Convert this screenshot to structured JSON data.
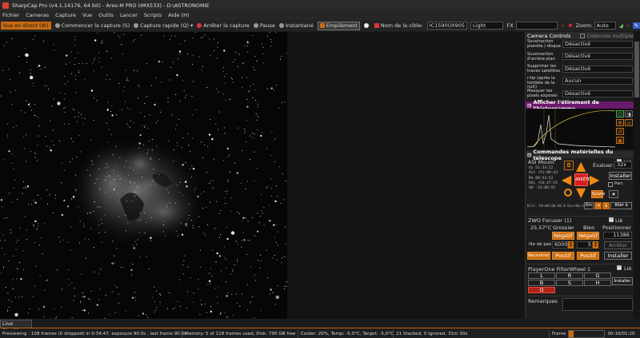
{
  "title": "SharpCap Pro (v4.1.14176, 64 bit) - Ares-M PRO (IMX533) - D:\\ASTRONOMIE",
  "menu": [
    "Fichier",
    "Cameras",
    "Capture",
    "Vue",
    "Outils",
    "Lancer",
    "Scripts",
    "Aide (H)"
  ],
  "toolbar": {
    "live_view": "Vue en direct (W)",
    "start_capture": "Commencer la capture (S)",
    "quick_capture": "Capture rapide (Q)",
    "stop_capture": "Arrêter la capture",
    "pause": "Pause",
    "snapshot": "Instantané",
    "stacking": "Empilement",
    "target_label": "Nom de la cible:",
    "target_value": "IC1590(IX905",
    "frame_type": "Light",
    "fx_label": "FX",
    "zoom_label": "Zoom:",
    "zoom_value": "Auto"
  },
  "panel": {
    "camera_controls": "Camera Controls",
    "multiple_columns": "Colonnes multiples",
    "rows": [
      {
        "label": "Soustraction planète / disque",
        "value": "Désactivé"
      },
      {
        "label": "Soustraction d'arrière-plan",
        "value": "Désactivé"
      },
      {
        "label": "Supprimer les traces satellites",
        "value": "Désactivé"
      },
      {
        "label": "r-tip (après la tombée de la nuit)",
        "value": "Aucun"
      },
      {
        "label": "Masquer les pixels exposés",
        "value": "Désactivé"
      }
    ],
    "histogram_title": "Afficher l'étirement de l'histogramme",
    "telescope_title": "Commandes matérielles du télescope",
    "mount_name": "ASI Mount",
    "link_label": "Lié",
    "evaluate_label": "Évaluer:",
    "evaluate_value": "32x",
    "install_label": "Installer",
    "stop_label": "ARRÊTER",
    "follow_label": "Suivre",
    "go_to_label": "Aller à",
    "pad_label": "Parc",
    "mount_coords": [
      "Az    51:34:52",
      "ALt   +51:09:43",
      "RA    00:54:52",
      "Déc  +54:47:55",
      "AH    -24:09:55"
    ],
    "mount_footer": "Dist. RA+00:00:00.0 Dec+00:47:00",
    "focuser_name": "ZWO Focuser (1)",
    "temp": "25.57°C",
    "coarse": "Grossier",
    "fine": "Bien",
    "position_label": "Positionner",
    "position_value": "11386",
    "negative": "Négatif",
    "positive": "Positif",
    "step_label": "ille de pas",
    "step_coarse": "6000",
    "step_fine": "5",
    "stop": "Arrêter",
    "recenter": "Recentrer",
    "filterwheel_name": "PlayerOne FilterWheel 1",
    "filters": [
      "L",
      "R",
      "G",
      "B",
      "S",
      "H",
      "O"
    ],
    "remarks_label": "Remarques"
  },
  "live_stacking": "Live Stacking",
  "status": {
    "preview": "Previewing : 108 frames (0 dropped) in 0:34:47, exposure 90.0s , last frame 90.0s",
    "memory": "Memory: 5 of 118 frames used, Disk: 795 GB free",
    "cooler": "Cooler: 20%, Temp: -5,0°C, Target: -5,0°C",
    "stacked": "21 Stacked, 0 Ignored, 31m 30s",
    "frame_label": "Frame",
    "time": "00:10/01:20"
  }
}
